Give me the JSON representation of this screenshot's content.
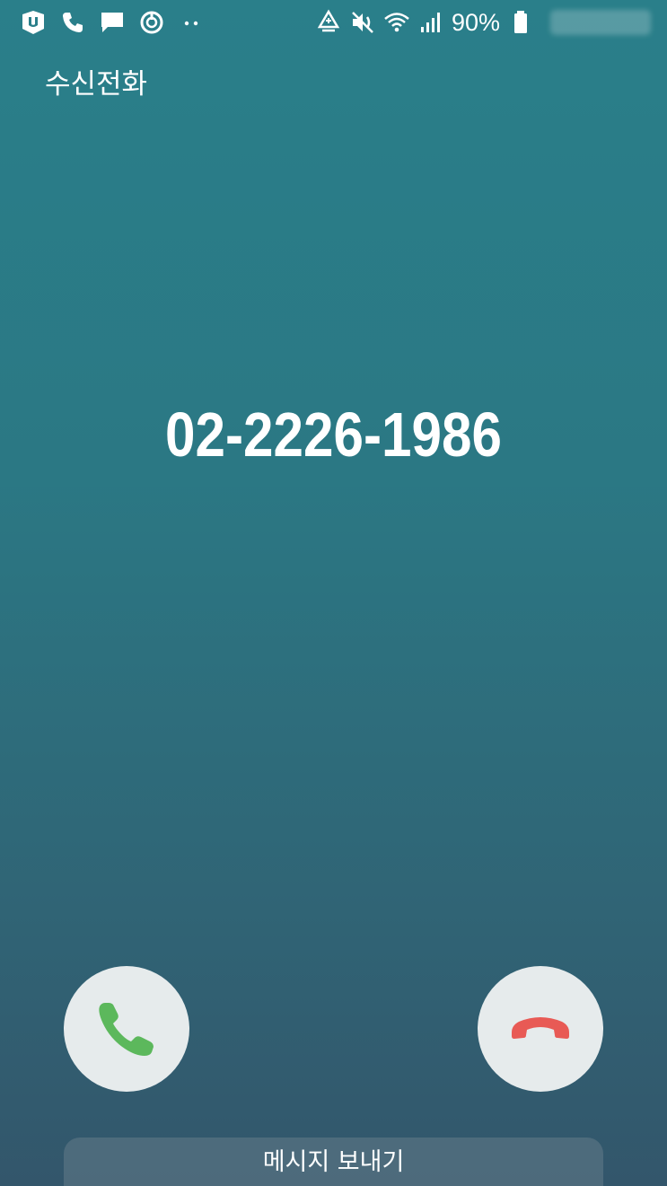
{
  "status_bar": {
    "left_icons": [
      "app-u-icon",
      "phone-icon",
      "message-icon",
      "sync-icon",
      "more-dots-icon"
    ],
    "right_icons": [
      "data-saver-icon",
      "vibrate-mute-icon",
      "wifi-icon",
      "signal-icon",
      "battery-icon"
    ],
    "battery_percent": "90%"
  },
  "call": {
    "label": "수신전화",
    "number": "02-2226-1986"
  },
  "actions": {
    "accept_icon": "phone-accept-icon",
    "decline_icon": "phone-decline-icon",
    "accept_color": "#5cb85c",
    "decline_color": "#e85a55",
    "message_label": "메시지 보내기"
  },
  "colors": {
    "background_top": "#2a7f8a",
    "background_bottom": "#33566b",
    "button_bg": "#e6ebec"
  }
}
